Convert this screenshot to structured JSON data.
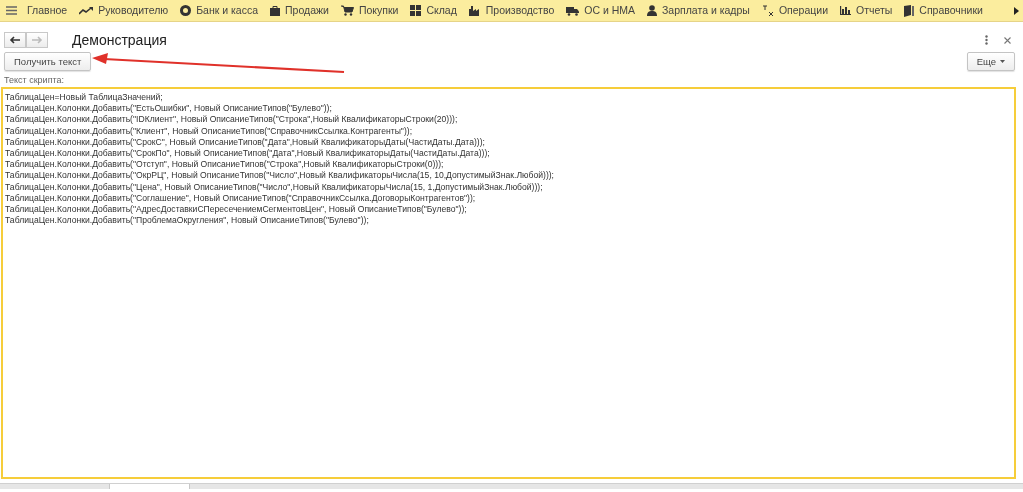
{
  "menu": [
    {
      "kind": "trend",
      "label": "Руководителю"
    },
    {
      "kind": "coin",
      "label": "Банк и касса"
    },
    {
      "kind": "bag",
      "label": "Продажи"
    },
    {
      "kind": "cart",
      "label": "Покупки"
    },
    {
      "kind": "grid",
      "label": "Склад"
    },
    {
      "kind": "factory",
      "label": "Производство"
    },
    {
      "kind": "truck",
      "label": "ОС и НМА"
    },
    {
      "kind": "person",
      "label": "Зарплата и кадры"
    },
    {
      "kind": "ledger",
      "label": "Операции"
    },
    {
      "kind": "chart",
      "label": "Отчеты"
    },
    {
      "kind": "book",
      "label": "Справочники"
    }
  ],
  "menu_home": "Главное",
  "window": {
    "title": "Демонстрация",
    "back_disabled": false,
    "forward_disabled": true
  },
  "toolbar": {
    "button": "Получить текст",
    "more": "Еще"
  },
  "script": {
    "label": "Текст скрипта:",
    "lines": [
      "ТаблицаЦен=Новый ТаблицаЗначений;",
      "ТаблицаЦен.Колонки.Добавить(\"ЕстьОшибки\", Новый ОписаниеТипов(\"Булево\"));",
      "ТаблицаЦен.Колонки.Добавить(\"IDКлиент\", Новый ОписаниеТипов(\"Строка\",Новый КвалификаторыСтроки(20)));",
      "ТаблицаЦен.Колонки.Добавить(\"Клиент\", Новый ОписаниеТипов(\"СправочникСсылка.Контрагенты\"));",
      "ТаблицаЦен.Колонки.Добавить(\"СрокС\", Новый ОписаниеТипов(\"Дата\",Новый КвалификаторыДаты(ЧастиДаты.Дата)));",
      "ТаблицаЦен.Колонки.Добавить(\"СрокПо\", Новый ОписаниеТипов(\"Дата\",Новый КвалификаторыДаты(ЧастиДаты.Дата)));",
      "ТаблицаЦен.Колонки.Добавить(\"Отступ\", Новый ОписаниеТипов(\"Строка\",Новый КвалификаторыСтроки(0)));",
      "ТаблицаЦен.Колонки.Добавить(\"ОкрРЦ\", Новый ОписаниеТипов(\"Число\",Новый КвалификаторыЧисла(15, 10,ДопустимыйЗнак.Любой)));",
      "ТаблицаЦен.Колонки.Добавить(\"Цена\", Новый ОписаниеТипов(\"Число\",Новый КвалификаторыЧисла(15, 1,ДопустимыйЗнак.Любой)));",
      "ТаблицаЦен.Колонки.Добавить(\"Соглашение\", Новый ОписаниеТипов(\"СправочникСсылка.ДоговорыКонтрагентов\"));",
      "ТаблицаЦен.Колонки.Добавить(\"АдресДоставкиСПересечениемСегментовЦен\", Новый ОписаниеТипов(\"Булево\"));",
      "ТаблицаЦен.Колонки.Добавить(\"ПроблемаОкругления\", Новый ОписаниеТипов(\"Булево\"));"
    ]
  }
}
